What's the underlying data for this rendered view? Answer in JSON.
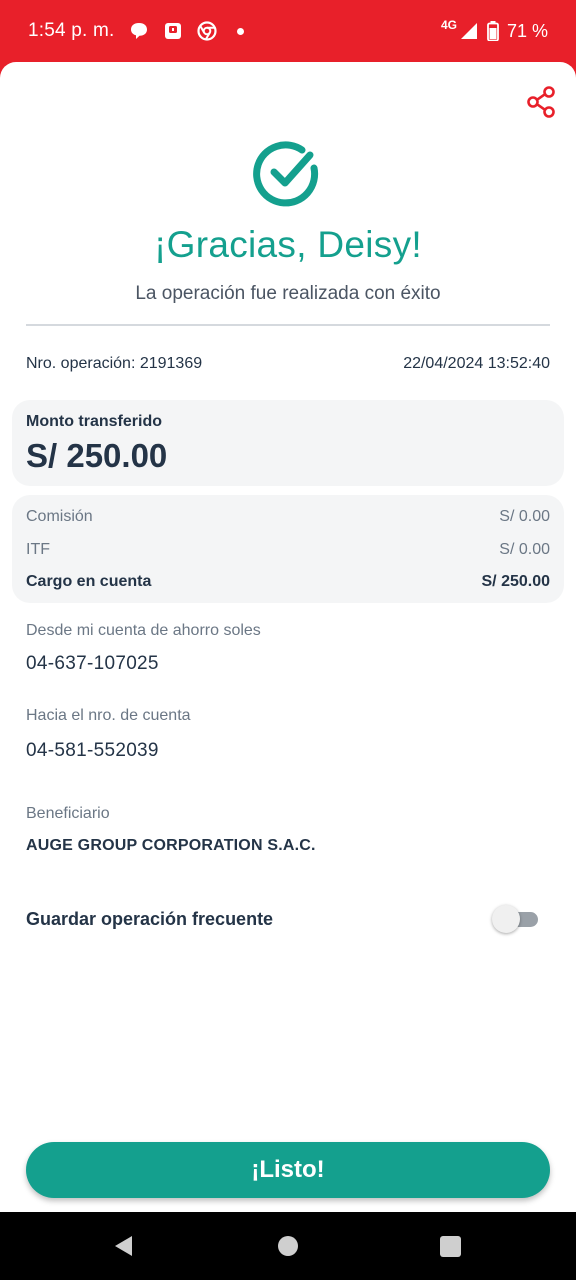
{
  "status_bar": {
    "time": "1:54 p. m.",
    "network": "4G",
    "battery": "71 %",
    "icons": [
      "chat-bubble-icon",
      "app-notification-icon",
      "chrome-icon",
      "more-dot-icon",
      "signal-icon",
      "battery-icon"
    ]
  },
  "header": {
    "share_icon": "share-icon",
    "success_icon": "check-circle-icon",
    "title": "¡Gracias, Deisy!",
    "subtitle": "La operación fue realizada con éxito"
  },
  "operation": {
    "number_label": "Nro. operación: 2191369",
    "datetime": "22/04/2024 13:52:40"
  },
  "amount": {
    "label": "Monto transferido",
    "value": "S/ 250.00"
  },
  "fees": [
    {
      "label": "Comisión",
      "value": "S/ 0.00"
    },
    {
      "label": "ITF",
      "value": "S/ 0.00"
    },
    {
      "label": "Cargo en cuenta",
      "value": "S/ 250.00"
    }
  ],
  "from_account": {
    "label": "Desde mi cuenta de ahorro soles",
    "value": "04-637-107025"
  },
  "to_account": {
    "label": "Hacia el nro. de cuenta",
    "value": "04-581-552039"
  },
  "beneficiary": {
    "label": "Beneficiario",
    "value": "AUGE GROUP CORPORATION S.A.C."
  },
  "frequent": {
    "label": "Guardar operación frecuente",
    "enabled": false
  },
  "primary_button": {
    "label": "¡Listo!"
  },
  "colors": {
    "brand_red": "#e8202a",
    "accent_teal": "#14a08e",
    "text_dark": "#243447",
    "text_muted": "#6b7785",
    "panel_bg": "#f4f5f6"
  },
  "nav_bar": {
    "icons": [
      "back-icon",
      "home-icon",
      "recents-icon"
    ]
  }
}
